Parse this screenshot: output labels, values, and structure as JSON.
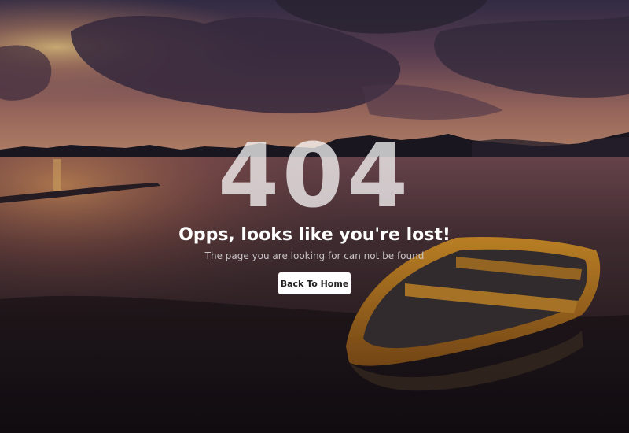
{
  "error": {
    "code": "404",
    "title": "Opps, looks like you're lost!",
    "subtitle": "The page you are looking for can not be found",
    "button_label": "Back To Home"
  },
  "colors": {
    "button_bg": "#ffffff",
    "title_text": "#ffffff",
    "subtitle_text": "#c8c2c4"
  }
}
